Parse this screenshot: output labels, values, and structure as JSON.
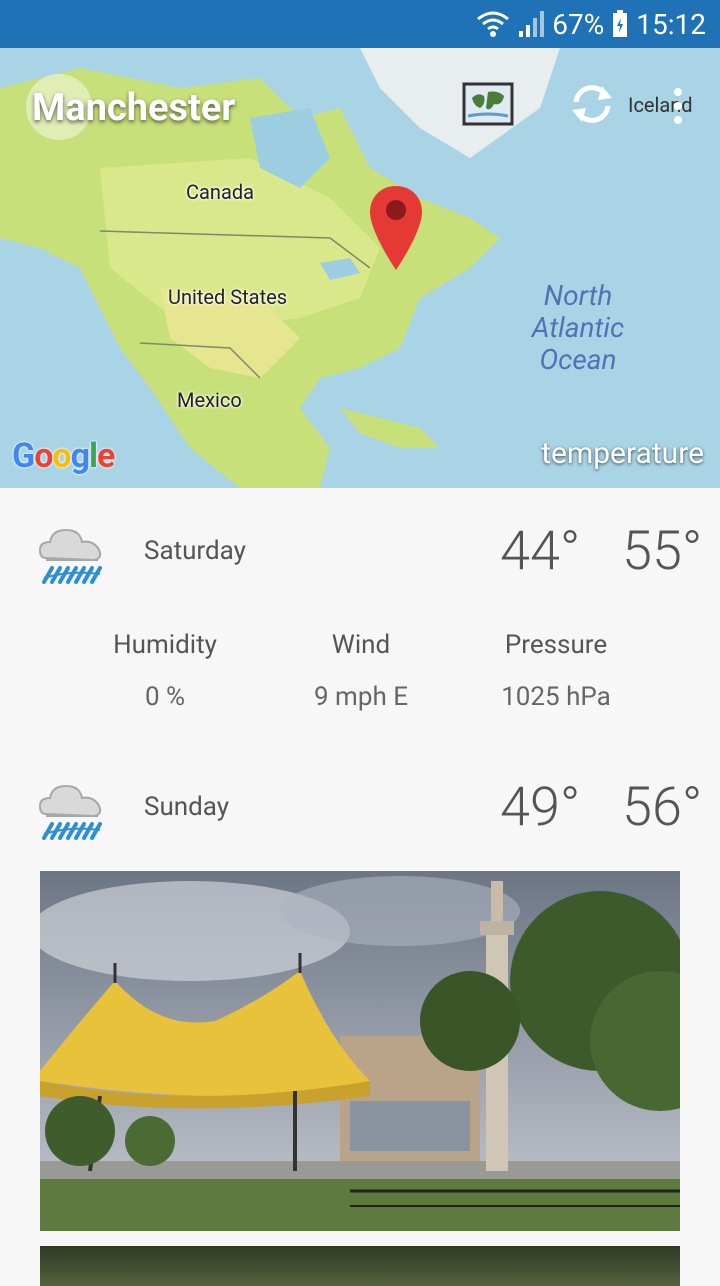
{
  "status_bar": {
    "battery": "67%",
    "time": "15:12"
  },
  "header": {
    "city": "Manchester",
    "nearby_label": "Iceland"
  },
  "map": {
    "labels": {
      "canada": "Canada",
      "united_states": "United States",
      "mexico": "Mexico",
      "ocean_line1": "North",
      "ocean_line2": "Atlantic",
      "ocean_line3": "Ocean"
    },
    "google_logo": "Google",
    "layer_name": "temperature"
  },
  "forecast": [
    {
      "day": "Saturday",
      "low": "44°",
      "high": "55°",
      "icon": "rain-cloud-icon"
    },
    {
      "day": "Sunday",
      "low": "49°",
      "high": "56°",
      "icon": "rain-cloud-icon"
    }
  ],
  "details": {
    "humidity_label": "Humidity",
    "humidity_value": "0 %",
    "wind_label": "Wind",
    "wind_value": "9 mph E",
    "pressure_label": "Pressure",
    "pressure_value": "1025 hPa"
  },
  "colors": {
    "status_bar": "#1f72b6",
    "pin": "#e53935",
    "rain": "#2f8fd0"
  }
}
